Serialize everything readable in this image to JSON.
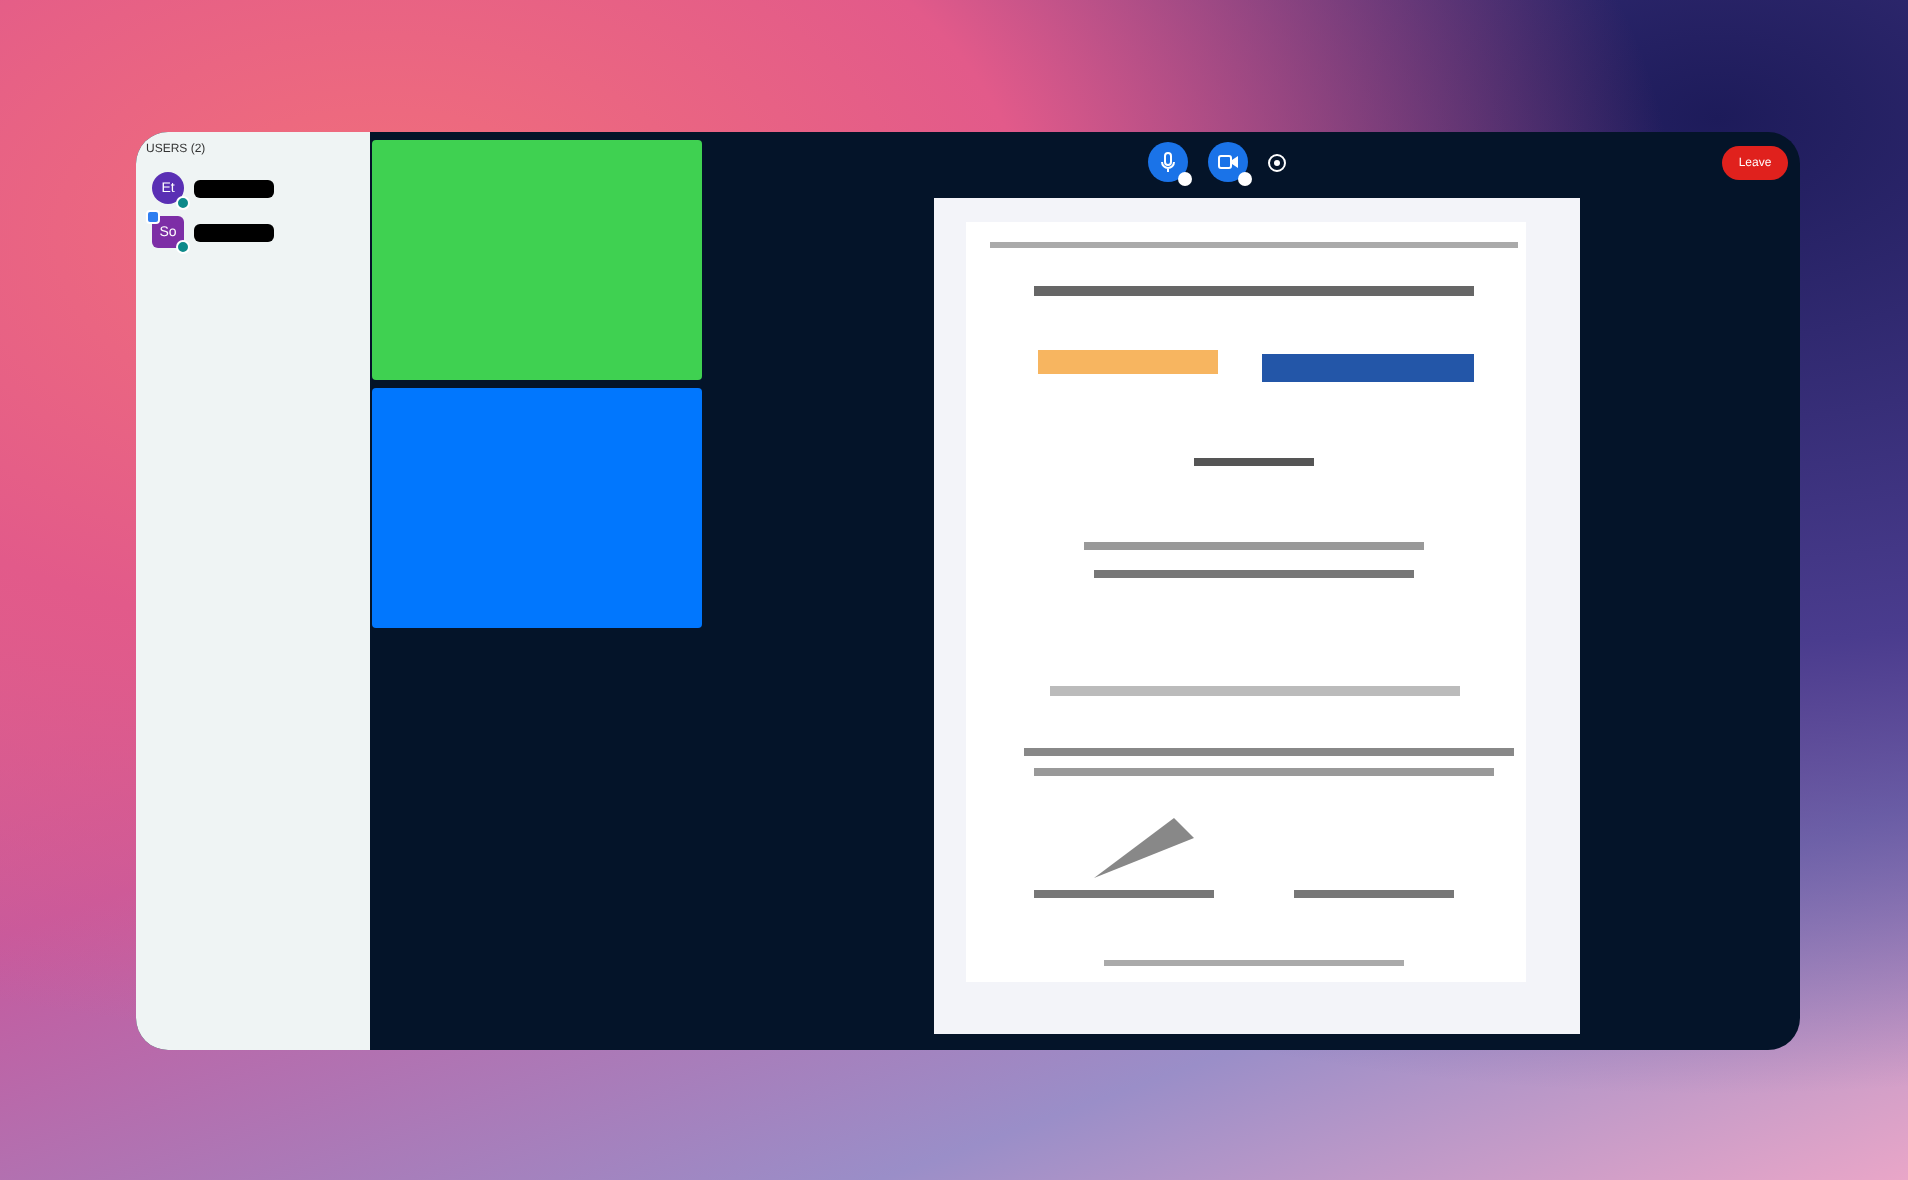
{
  "users_panel": {
    "title": "USERS (2)",
    "users": [
      {
        "initials": "Et",
        "color": "#5a2fb4",
        "presenter": false
      },
      {
        "initials": "So",
        "color": "#7d2ea6",
        "presenter": true
      }
    ]
  },
  "video_tiles": [
    {
      "color": "#3fd151"
    },
    {
      "color": "#0177fe"
    }
  ],
  "toolbar": {
    "leave": "Leave"
  }
}
